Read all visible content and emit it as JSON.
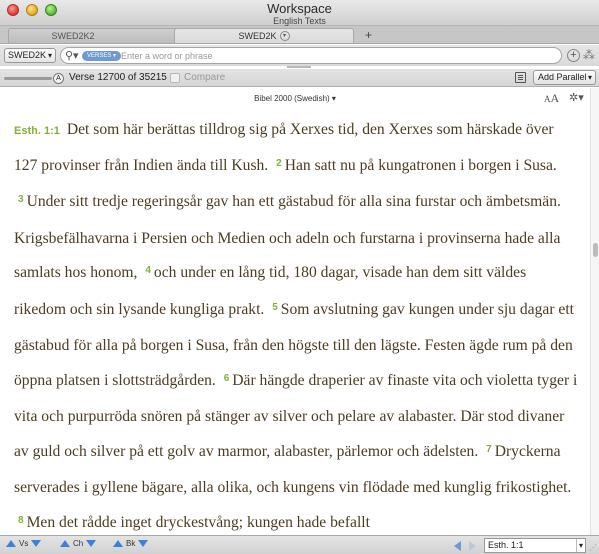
{
  "window": {
    "title": "Workspace",
    "subtitle": "English Texts"
  },
  "tabs": [
    {
      "label": "SWED2K2"
    },
    {
      "label": "SWED2K"
    }
  ],
  "new_tab_label": "+",
  "search": {
    "bible_selector": "SWED2K",
    "scope_pill": "VERSES",
    "placeholder": "Enter a word or phrase"
  },
  "verse_bar": {
    "position_text": "Verse 12700 of 35215",
    "compare_label": "Compare",
    "add_parallel_label": "Add Parallel"
  },
  "content_header": {
    "translation": "Bibel 2000 (Swedish) ▾",
    "font_small": "A",
    "font_large": "A"
  },
  "scripture": {
    "reference": "Esth. 1:1",
    "verses": [
      {
        "num": "",
        "text": "Det som här berättas tilldrog sig på Xerxes tid, den Xerxes som härskade över 127 provinser från Indien ända till Kush."
      },
      {
        "num": "2",
        "text": "Han satt nu på kungatronen i borgen i Susa."
      },
      {
        "num": "3",
        "text": "Under sitt tredje regeringsår gav han ett gästabud för alla sina furstar och ämbetsmän. Krigsbefälhavarna i Persien och Medien och adeln och furstarna i provinserna hade alla samlats hos honom,"
      },
      {
        "num": "4",
        "text": "och under en lång tid, 180 dagar, visade han dem sitt väldes rikedom och sin lysande kungliga prakt."
      },
      {
        "num": "5",
        "text": "Som avslutning gav kungen under sju dagar ett gästabud för alla på borgen i Susa, från den högste till den lägste. Festen ägde rum på den öppna platsen i slottsträdgården."
      },
      {
        "num": "6",
        "text": "Där hängde draperier av finaste vita och violetta tyger i vita och purpurröda snören på stänger av silver och pelare av alabaster. Där stod divaner av guld och silver på ett golv av marmor, alabaster, pärlemor och ädelsten."
      },
      {
        "num": "7",
        "text": "Dryckerna serverades i gyllene bägare, alla olika, och kungens vin flödade med kunglig frikostighet."
      },
      {
        "num": "8",
        "text": "Men det rådde inget dryckestvång; kungen hade befallt"
      }
    ]
  },
  "bottom_bar": {
    "nav_verse": "Vs",
    "nav_chapter": "Ch",
    "nav_book": "Bk",
    "reference_value": "Esth. 1:1"
  },
  "colors": {
    "verse_number": "#80b13a",
    "text": "#4c3c22",
    "accent_blue": "#3b82d6"
  }
}
